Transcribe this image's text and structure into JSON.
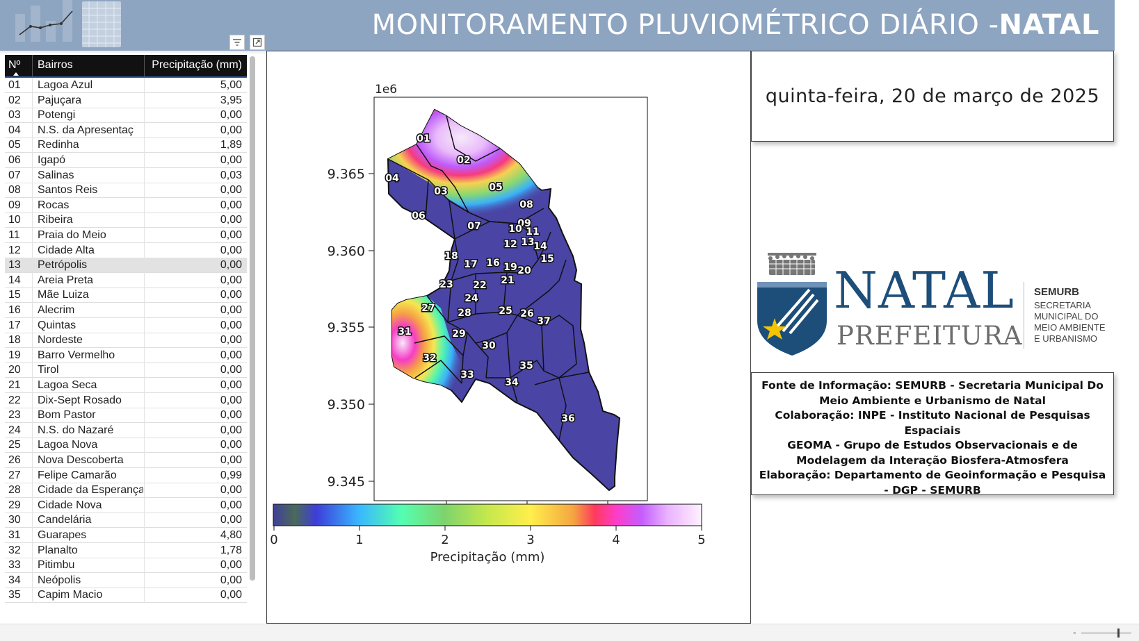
{
  "header": {
    "title_prefix": "MONITORAMENTO PLUVIOMÉTRICO DIÁRIO -",
    "title_bold": "NATAL"
  },
  "table": {
    "columns": [
      "Nº",
      "Bairros",
      "Precipitação (mm)"
    ],
    "rows": [
      {
        "num": "01",
        "bairro": "Lagoa Azul",
        "prec": "5,00"
      },
      {
        "num": "02",
        "bairro": "Pajuçara",
        "prec": "3,95"
      },
      {
        "num": "03",
        "bairro": "Potengi",
        "prec": "0,00"
      },
      {
        "num": "04",
        "bairro": "N.S. da Apresentaç",
        "prec": "0,00"
      },
      {
        "num": "05",
        "bairro": "Redinha",
        "prec": "1,89"
      },
      {
        "num": "06",
        "bairro": "Igapó",
        "prec": "0,00"
      },
      {
        "num": "07",
        "bairro": "Salinas",
        "prec": "0,03"
      },
      {
        "num": "08",
        "bairro": "Santos Reis",
        "prec": "0,00"
      },
      {
        "num": "09",
        "bairro": "Rocas",
        "prec": "0,00"
      },
      {
        "num": "10",
        "bairro": "Ribeira",
        "prec": "0,00"
      },
      {
        "num": "11",
        "bairro": "Praia do Meio",
        "prec": "0,00"
      },
      {
        "num": "12",
        "bairro": "Cidade Alta",
        "prec": "0,00"
      },
      {
        "num": "13",
        "bairro": "Petrópolis",
        "prec": "0,00"
      },
      {
        "num": "14",
        "bairro": "Areia Preta",
        "prec": "0,00"
      },
      {
        "num": "15",
        "bairro": "Mãe Luiza",
        "prec": "0,00"
      },
      {
        "num": "16",
        "bairro": "Alecrim",
        "prec": "0,00"
      },
      {
        "num": "17",
        "bairro": "Quintas",
        "prec": "0,00"
      },
      {
        "num": "18",
        "bairro": "Nordeste",
        "prec": "0,00"
      },
      {
        "num": "19",
        "bairro": "Barro Vermelho",
        "prec": "0,00"
      },
      {
        "num": "20",
        "bairro": "Tirol",
        "prec": "0,00"
      },
      {
        "num": "21",
        "bairro": "Lagoa Seca",
        "prec": "0,00"
      },
      {
        "num": "22",
        "bairro": "Dix-Sept Rosado",
        "prec": "0,00"
      },
      {
        "num": "23",
        "bairro": "Bom Pastor",
        "prec": "0,00"
      },
      {
        "num": "24",
        "bairro": "N.S. do Nazaré",
        "prec": "0,00"
      },
      {
        "num": "25",
        "bairro": "Lagoa Nova",
        "prec": "0,00"
      },
      {
        "num": "26",
        "bairro": "Nova Descoberta",
        "prec": "0,00"
      },
      {
        "num": "27",
        "bairro": "Felipe Camarão",
        "prec": "0,99"
      },
      {
        "num": "28",
        "bairro": "Cidade da Esperança",
        "prec": "0,00"
      },
      {
        "num": "29",
        "bairro": "Cidade Nova",
        "prec": "0,00"
      },
      {
        "num": "30",
        "bairro": "Candelária",
        "prec": "0,00"
      },
      {
        "num": "31",
        "bairro": "Guarapes",
        "prec": "4,80"
      },
      {
        "num": "32",
        "bairro": "Planalto",
        "prec": "1,78"
      },
      {
        "num": "33",
        "bairro": "Pitimbu",
        "prec": "0,00"
      },
      {
        "num": "34",
        "bairro": "Neópolis",
        "prec": "0,00"
      },
      {
        "num": "35",
        "bairro": "Capim Macio",
        "prec": "0,00"
      }
    ],
    "selected_row": 12
  },
  "map": {
    "offset_label": "1e6",
    "y_ticks": [
      "9.365",
      "9.360",
      "9.355",
      "9.350",
      "9.345"
    ],
    "x_ticks": [
      "250000",
      "255000",
      "260000"
    ],
    "colorbar_ticks": [
      "0",
      "1",
      "2",
      "3",
      "4",
      "5"
    ],
    "colorbar_label": "Precipitação (mm)",
    "district_labels": [
      "01",
      "02",
      "03",
      "04",
      "05",
      "06",
      "07",
      "08",
      "09",
      "10",
      "11",
      "12",
      "13",
      "14",
      "15",
      "16",
      "17",
      "18",
      "19",
      "20",
      "21",
      "22",
      "23",
      "24",
      "25",
      "26",
      "27",
      "28",
      "29",
      "30",
      "31",
      "32",
      "33",
      "34",
      "35",
      "36",
      "37"
    ]
  },
  "date_card": {
    "text": "quinta-feira, 20 de março de 2025"
  },
  "logo": {
    "natal": "NATAL",
    "prefeitura": "PREFEITURA",
    "semurb": "SEMURB",
    "secretaria": "SECRETARIA\nMUNICIPAL DO\nMEIO AMBIENTE\nE URBANISMO"
  },
  "info_card": {
    "line1": "Fonte de Informação: SEMURB - Secretaria Municipal Do Meio Ambiente e Urbanismo de Natal",
    "line2": "Colaboração:  INPE - Instituto Nacional de Pesquisas Espaciais",
    "line3": "GEOMA - Grupo de Estudos Observacionais e de Modelagem da Interação Biosfera-Atmosfera",
    "line4": "Elaboração: Departamento de Geoinformação e Pesquisa - DGP - SEMURB"
  },
  "bottom_bar": {
    "zoom_minus": "-"
  },
  "colors": {
    "header_bg": "#8ea5c1",
    "map_base": "#4a44a4",
    "natal_blue": "#1d4e7a",
    "star_yellow": "#f5c400"
  }
}
